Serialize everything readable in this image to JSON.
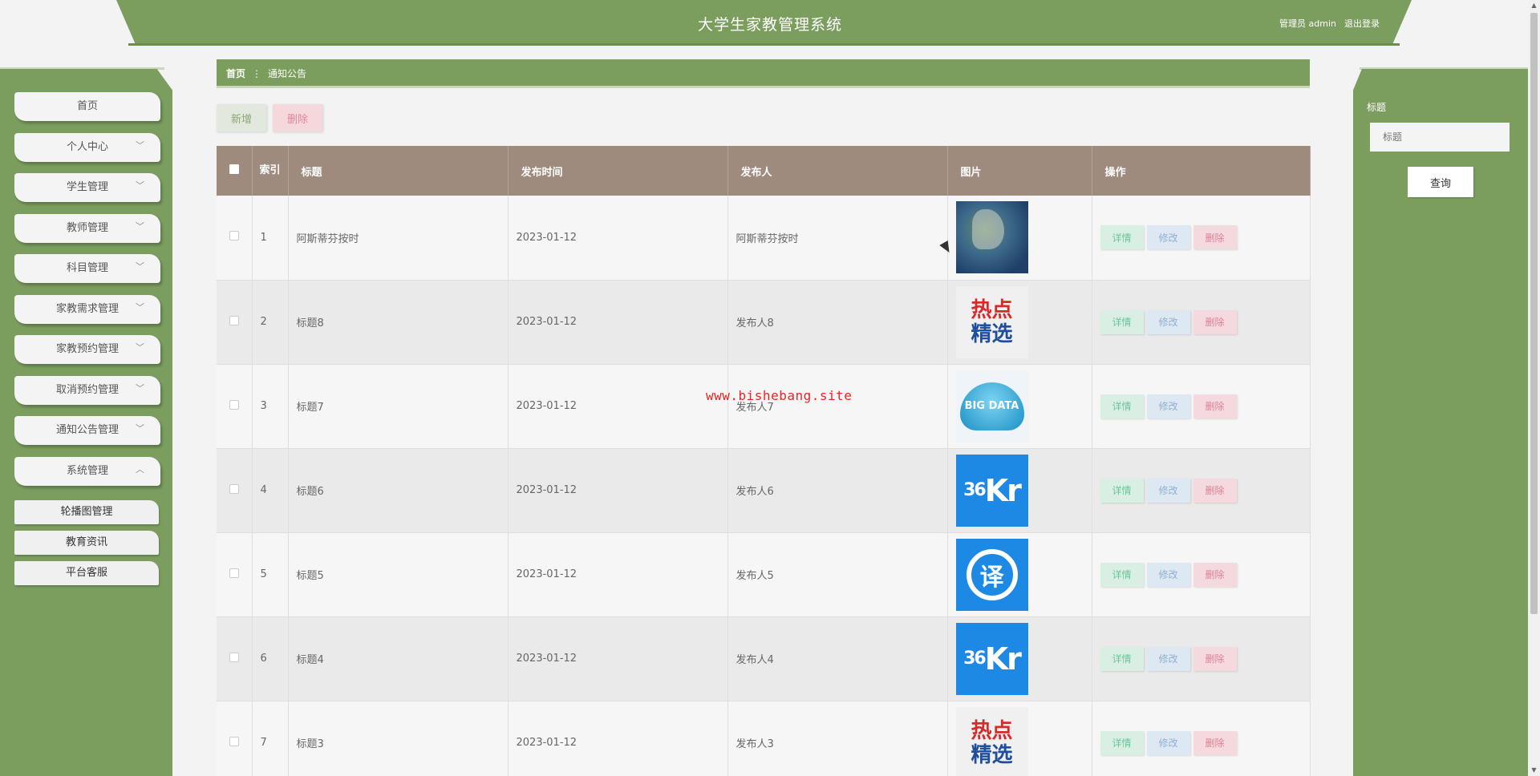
{
  "header": {
    "title": "大学生家教管理系统",
    "user_label": "管理员 admin",
    "logout_label": "退出登录"
  },
  "sidebar": {
    "items": [
      {
        "label": "首页",
        "has_chevron": false
      },
      {
        "label": "个人中心",
        "has_chevron": true,
        "chevron": "﹀"
      },
      {
        "label": "学生管理",
        "has_chevron": true,
        "chevron": "﹀"
      },
      {
        "label": "教师管理",
        "has_chevron": true,
        "chevron": "﹀"
      },
      {
        "label": "科目管理",
        "has_chevron": true,
        "chevron": "﹀"
      },
      {
        "label": "家教需求管理",
        "has_chevron": true,
        "chevron": "﹀"
      },
      {
        "label": "家教预约管理",
        "has_chevron": true,
        "chevron": "﹀"
      },
      {
        "label": "取消预约管理",
        "has_chevron": true,
        "chevron": "﹀"
      },
      {
        "label": "通知公告管理",
        "has_chevron": true,
        "chevron": "﹀"
      },
      {
        "label": "系统管理",
        "has_chevron": true,
        "chevron": "︿"
      }
    ],
    "subitems": [
      {
        "label": "轮播图管理"
      },
      {
        "label": "教育资讯"
      },
      {
        "label": "平台客服"
      }
    ]
  },
  "breadcrumb": {
    "home": "首页",
    "separator": "⋮",
    "current": "通知公告"
  },
  "actions": {
    "add_label": "新增",
    "delete_label": "删除"
  },
  "table": {
    "headers": {
      "index": "索引",
      "title": "标题",
      "time": "发布时间",
      "publisher": "发布人",
      "image": "图片",
      "ops": "操作"
    },
    "op_labels": {
      "detail": "详情",
      "edit": "修改",
      "remove": "删除"
    },
    "rows": [
      {
        "index": "1",
        "title": "阿斯蒂芬按时",
        "time": "2023-01-12",
        "publisher": "阿斯蒂芬按时",
        "image": "satellite-image"
      },
      {
        "index": "2",
        "title": "标题8",
        "time": "2023-01-12",
        "publisher": "发布人8",
        "image": "hot-picks-image"
      },
      {
        "index": "3",
        "title": "标题7",
        "time": "2023-01-12",
        "publisher": "发布人7",
        "image": "big-data-image"
      },
      {
        "index": "4",
        "title": "标题6",
        "time": "2023-01-12",
        "publisher": "发布人6",
        "image": "36kr-image"
      },
      {
        "index": "5",
        "title": "标题5",
        "time": "2023-01-12",
        "publisher": "发布人5",
        "image": "translate-image"
      },
      {
        "index": "6",
        "title": "标题4",
        "time": "2023-01-12",
        "publisher": "发布人4",
        "image": "36kr-image"
      },
      {
        "index": "7",
        "title": "标题3",
        "time": "2023-01-12",
        "publisher": "发布人3",
        "image": "hot-picks-image"
      }
    ]
  },
  "image_text": {
    "hot_a": "热点",
    "hot_b": "精选",
    "big_data": "BIG DATA",
    "kr_num": "36",
    "kr_txt": "Kr",
    "yi": "译"
  },
  "search": {
    "label": "标题",
    "placeholder": "标题",
    "button_label": "查询"
  },
  "watermark": "www.bishebang.site",
  "colors": {
    "primary_green": "#7b9e5f",
    "table_header": "#9e8b7e",
    "detail": "#6cc49a",
    "edit": "#8fb0d3",
    "remove": "#e08095"
  }
}
